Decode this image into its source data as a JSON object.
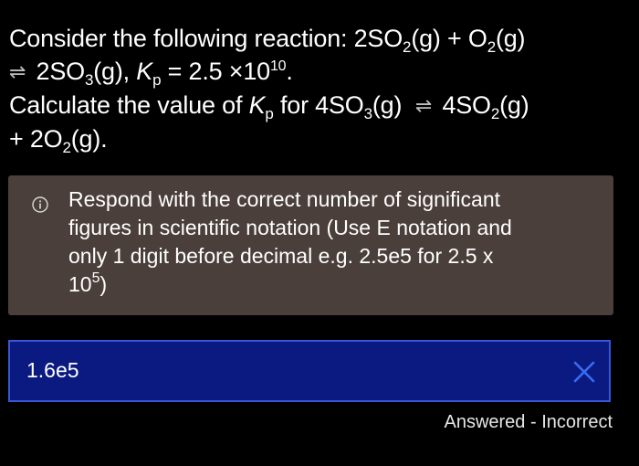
{
  "question": {
    "line1_prefix": "Consider the following reaction: 2SO",
    "line1_sub1": "2",
    "line1_mid": "(g) + O",
    "line1_sub2": "2",
    "line1_end": "(g)",
    "line2_arrow": "⇌",
    "line2_prefix": "2SO",
    "line2_sub1": "3",
    "line2_mid": "(g), ",
    "line2_k": "K",
    "line2_ksub": "p",
    "line2_eq": " = 2.5 ×10",
    "line2_exp": "10",
    "line2_end": ".",
    "line3_prefix": "Calculate the value of ",
    "line3_k": "K",
    "line3_ksub": "p",
    "line3_mid": " for 4SO",
    "line3_sub1": "3",
    "line3_g": "(g)",
    "line3_arrow": "⇌",
    "line3_so": "4SO",
    "line3_sub2": "2",
    "line3_end": "(g)",
    "line4_prefix": "+ 2O",
    "line4_sub": "2",
    "line4_end": "(g)."
  },
  "info": {
    "icon": "info-circle-icon",
    "line1": "Respond with the correct number of significant",
    "line2": "figures in scientific notation (Use E notation and",
    "line3": "only 1 digit before decimal e.g. 2.5e5 for 2.5 x",
    "line4_base": "10",
    "line4_exp": "5",
    "line4_end": ")"
  },
  "answer": {
    "value": "1.6e5",
    "result_icon": "x-icon"
  },
  "status": {
    "text": "Answered - Incorrect"
  },
  "colors": {
    "background": "#000000",
    "info_box": "#4b3f3b",
    "answer_box": "#0a1a80",
    "answer_border": "#3a56d8",
    "incorrect_x": "#3a6cf0"
  }
}
